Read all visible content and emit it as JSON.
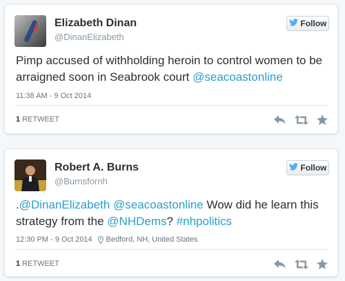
{
  "tweets": [
    {
      "author": "Elizabeth Dinan",
      "handle": "@DinanElizabeth",
      "follow_label": "Follow",
      "text_plain": "Pimp accused of withholding heroin to control women to be arraigned soon in Seabrook court ",
      "text_mention": "@seacoastonline",
      "timestamp": "11:38 AM - 9 Oct 2014",
      "retweet_count": "1",
      "retweet_label": "RETWEET"
    },
    {
      "author": "Robert A. Burns",
      "handle": "@Burnsfornh",
      "follow_label": "Follow",
      "text_parts": [
        {
          "text": ".",
          "mention": false
        },
        {
          "text": "@DinanElizabeth",
          "mention": true
        },
        {
          "text": " ",
          "mention": false
        },
        {
          "text": "@seacoastonline",
          "mention": true
        },
        {
          "text": " Wow did he learn this strategy from the  ",
          "mention": false
        },
        {
          "text": "@NHDems",
          "mention": true
        },
        {
          "text": "? ",
          "mention": false
        },
        {
          "text": "#nhpolitics",
          "mention": true
        }
      ],
      "timestamp": "12:30 PM - 9 Oct 2014",
      "location": "Bedford, NH, United States",
      "retweet_count": "1",
      "retweet_label": "RETWEET"
    }
  ],
  "colors": {
    "link": "#2b9ec8",
    "twitter_bird": "#55acee",
    "muted": "#66757f"
  },
  "icons": [
    "twitter-bird-icon",
    "reply-icon",
    "retweet-icon",
    "favorite-icon",
    "location-pin-icon"
  ]
}
